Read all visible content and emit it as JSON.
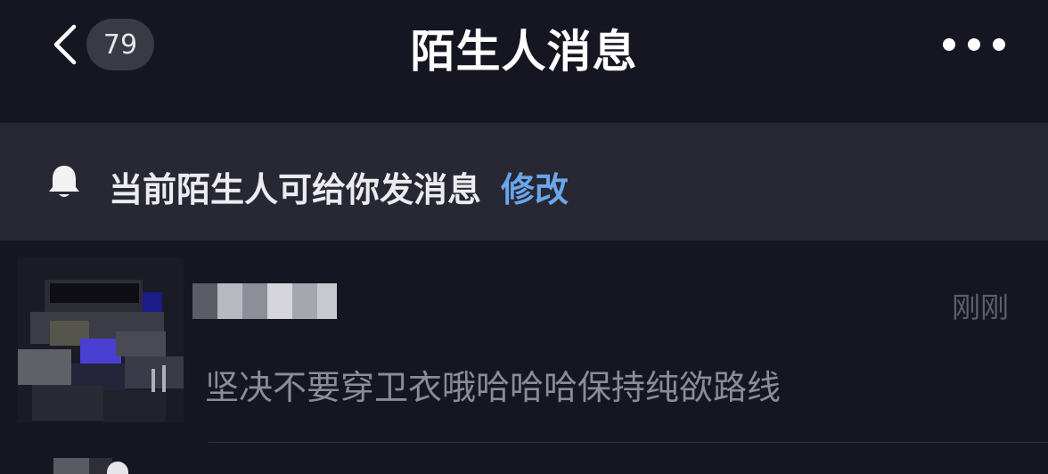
{
  "header": {
    "back_icon": "chevron-left-icon",
    "unread_count": "79",
    "title": "陌生人消息",
    "more_icon": "more-dots-icon"
  },
  "notice": {
    "icon": "bell-icon",
    "text": "当前陌生人可给你发消息",
    "link_label": "修改"
  },
  "messages": [
    {
      "name": "",
      "time": "刚刚",
      "preview": "坚决不要穿卫衣哦哈哈哈保持纯欲路线"
    }
  ],
  "colors": {
    "background": "#161622",
    "notice_bg": "#272833",
    "link": "#6aa6ec",
    "badge_bg": "#3a3a44",
    "preview_text": "#8b8c96",
    "time_text": "#5e5f6a"
  }
}
